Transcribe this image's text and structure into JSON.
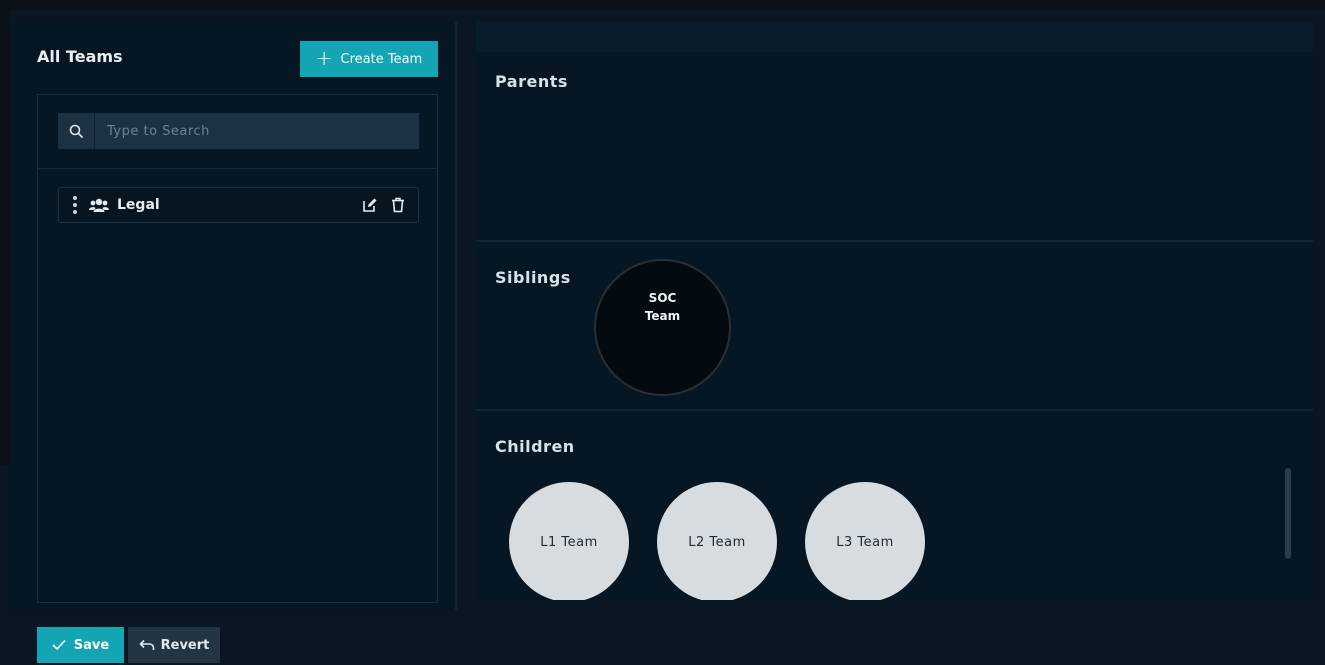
{
  "left_panel": {
    "title": "All Teams",
    "create_button_label": "Create Team",
    "search": {
      "placeholder": "Type to Search",
      "value": ""
    },
    "teams": [
      {
        "name": "Legal"
      }
    ]
  },
  "right_panel": {
    "parents": {
      "title": "Parents",
      "items": []
    },
    "siblings": {
      "title": "Siblings",
      "items": [
        {
          "line1": "SOC",
          "line2": "Team"
        }
      ]
    },
    "children": {
      "title": "Children",
      "items": [
        {
          "name": "L1 Team"
        },
        {
          "name": "L2 Team"
        },
        {
          "name": "L3 Team"
        }
      ]
    }
  },
  "footer": {
    "save_label": "Save",
    "revert_label": "Revert"
  },
  "colors": {
    "accent": "#14a5b4",
    "background": "#061723",
    "child_circle": "#d7dce0",
    "sibling_circle": "#030a10"
  },
  "icons": {
    "search": "search-icon",
    "plus": "plus-icon",
    "drag": "drag-handle-icon",
    "team": "users-icon",
    "edit": "edit-icon",
    "delete": "trash-icon",
    "check": "check-icon",
    "revert": "undo-arrow-icon"
  }
}
